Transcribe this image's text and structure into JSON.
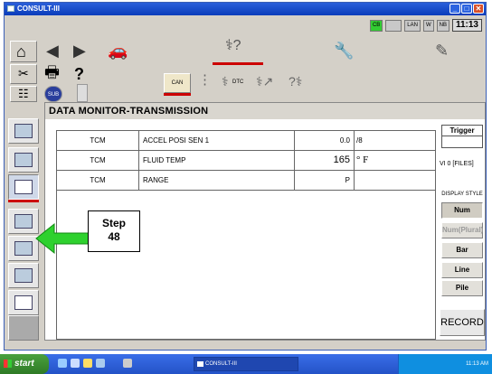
{
  "window": {
    "title": "CONSULT-III"
  },
  "status": {
    "box1": "CB",
    "box3": "LAN",
    "box4": "W",
    "box5": "NB",
    "clock": "11:13"
  },
  "toolbar": {
    "can_label": "CAN",
    "dtc_label": "DTC",
    "sub_label": "SUB"
  },
  "main": {
    "title": "DATA MONITOR-TRANSMISSION",
    "rows": [
      {
        "system": "TCM",
        "item": "ACCEL POSI SEN 1",
        "value": "0.0",
        "unit": "/8"
      },
      {
        "system": "TCM",
        "item": "FLUID TEMP",
        "value": "165",
        "unit": "° F"
      },
      {
        "system": "TCM",
        "item": "RANGE",
        "value": "P",
        "unit": ""
      }
    ]
  },
  "right_panel": {
    "trigger": "Trigger",
    "files": "VI    0 [FILES]",
    "display_style_label": "DISPLAY STYLE",
    "buttons": [
      "Num",
      "Num(Plural)",
      "Bar",
      "Line",
      "Pile"
    ],
    "record": "RECORD"
  },
  "annotation": {
    "line1": "Step",
    "line2": "48",
    "arrow_color": "#2ed12e"
  },
  "taskbar": {
    "start": "start",
    "task": "CONSULT-III",
    "tray_time": "11:13 AM"
  },
  "colors": {
    "title_blue": "#0a3cbb",
    "accent_red": "#cc0000",
    "taskbar_blue": "#2352c7"
  }
}
